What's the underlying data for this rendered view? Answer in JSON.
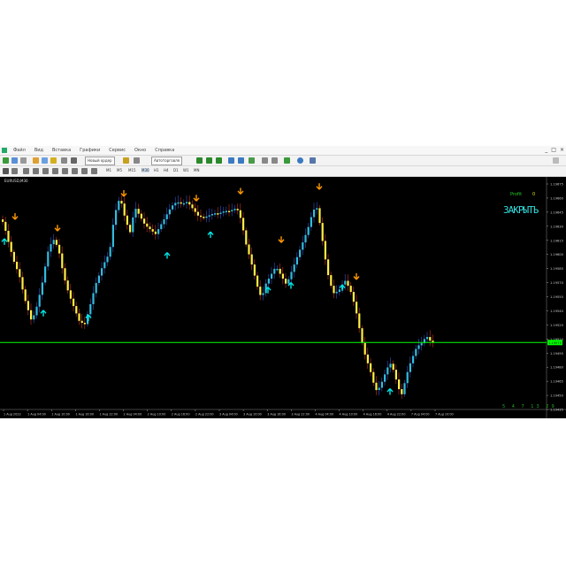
{
  "menu": [
    "Файл",
    "Вид",
    "Вставка",
    "Графики",
    "Сервис",
    "Окно",
    "Справка"
  ],
  "window_controls": [
    "_",
    "□",
    "×"
  ],
  "toolbar": {
    "new_order_label": "Новый ордер",
    "autotrading_label": "Автоторговля",
    "timeframes": [
      "M1",
      "M5",
      "M15",
      "M30",
      "H1",
      "H4",
      "D1",
      "W1",
      "MN"
    ]
  },
  "chart": {
    "symbol_label": "EURUSD,M30",
    "profit_label": "Profit",
    "profit_value": "0",
    "signal_text": "ЗАКРЫТЬ",
    "timer": "5 4 7 13 29",
    "current_price": "1.19575",
    "current_price_fraction": 0.71,
    "price_line_color": "#00ff00",
    "bull_color": "#33bbdd",
    "bear_color": "#ffee44",
    "up_arrow_color": "#00e5e5",
    "down_arrow_color": "#ff9900"
  },
  "chart_data": {
    "type": "candlestick",
    "y_ticks": [
      "1.19675",
      "1.19660",
      "1.19645",
      "1.19630",
      "1.19615",
      "1.19600",
      "1.19585",
      "1.19570",
      "1.19555",
      "1.19540",
      "1.19525",
      "1.19510",
      "1.19495",
      "1.19480",
      "1.19465",
      "1.19450",
      "1.19435"
    ],
    "x_ticks": [
      "1 Aug 2023",
      "1 Aug 04:00",
      "1 Aug 10:00",
      "1 Aug 16:00",
      "1 Aug 22:00",
      "2 Aug 04:00",
      "2 Aug 10:00",
      "2 Aug 16:00",
      "2 Aug 22:00",
      "3 Aug 04:00",
      "3 Aug 10:00",
      "3 Aug 16:00",
      "3 Aug 22:00",
      "4 Aug 04:00",
      "4 Aug 10:00",
      "4 Aug 16:00",
      "4 Aug 22:00",
      "7 Aug 04:00",
      "7 Aug 10:00"
    ],
    "price_path": [
      [
        0,
        0.17
      ],
      [
        6,
        0.19
      ],
      [
        12,
        0.28
      ],
      [
        18,
        0.36
      ],
      [
        24,
        0.42
      ],
      [
        30,
        0.52
      ],
      [
        38,
        0.62
      ],
      [
        44,
        0.55
      ],
      [
        50,
        0.45
      ],
      [
        56,
        0.32
      ],
      [
        62,
        0.26
      ],
      [
        68,
        0.3
      ],
      [
        74,
        0.42
      ],
      [
        80,
        0.5
      ],
      [
        86,
        0.56
      ],
      [
        92,
        0.62
      ],
      [
        98,
        0.63
      ],
      [
        104,
        0.55
      ],
      [
        110,
        0.46
      ],
      [
        118,
        0.38
      ],
      [
        126,
        0.32
      ],
      [
        130,
        0.2
      ],
      [
        134,
        0.12
      ],
      [
        138,
        0.08
      ],
      [
        142,
        0.15
      ],
      [
        146,
        0.2
      ],
      [
        150,
        0.24
      ],
      [
        154,
        0.12
      ],
      [
        160,
        0.16
      ],
      [
        166,
        0.2
      ],
      [
        172,
        0.22
      ],
      [
        178,
        0.24
      ],
      [
        184,
        0.2
      ],
      [
        190,
        0.16
      ],
      [
        196,
        0.12
      ],
      [
        202,
        0.1
      ],
      [
        208,
        0.11
      ],
      [
        214,
        0.1
      ],
      [
        220,
        0.13
      ],
      [
        226,
        0.16
      ],
      [
        232,
        0.17
      ],
      [
        238,
        0.16
      ],
      [
        244,
        0.15
      ],
      [
        250,
        0.15
      ],
      [
        256,
        0.14
      ],
      [
        262,
        0.14
      ],
      [
        268,
        0.13
      ],
      [
        272,
        0.14
      ],
      [
        276,
        0.2
      ],
      [
        280,
        0.28
      ],
      [
        286,
        0.36
      ],
      [
        290,
        0.42
      ],
      [
        294,
        0.48
      ],
      [
        298,
        0.52
      ],
      [
        302,
        0.46
      ],
      [
        308,
        0.42
      ],
      [
        314,
        0.38
      ],
      [
        320,
        0.42
      ],
      [
        326,
        0.46
      ],
      [
        332,
        0.4
      ],
      [
        338,
        0.34
      ],
      [
        344,
        0.28
      ],
      [
        350,
        0.22
      ],
      [
        356,
        0.14
      ],
      [
        360,
        0.12
      ],
      [
        364,
        0.2
      ],
      [
        368,
        0.3
      ],
      [
        372,
        0.4
      ],
      [
        376,
        0.46
      ],
      [
        380,
        0.5
      ],
      [
        386,
        0.48
      ],
      [
        392,
        0.44
      ],
      [
        398,
        0.48
      ],
      [
        404,
        0.56
      ],
      [
        408,
        0.64
      ],
      [
        412,
        0.72
      ],
      [
        416,
        0.78
      ],
      [
        420,
        0.82
      ],
      [
        424,
        0.88
      ],
      [
        428,
        0.92
      ],
      [
        432,
        0.9
      ],
      [
        436,
        0.86
      ],
      [
        440,
        0.82
      ],
      [
        444,
        0.8
      ],
      [
        448,
        0.84
      ],
      [
        452,
        0.9
      ],
      [
        456,
        0.94
      ],
      [
        460,
        0.88
      ],
      [
        464,
        0.82
      ],
      [
        468,
        0.78
      ],
      [
        472,
        0.74
      ],
      [
        476,
        0.72
      ],
      [
        480,
        0.71
      ],
      [
        484,
        0.68
      ],
      [
        488,
        0.7
      ],
      [
        490,
        0.71
      ]
    ],
    "down_arrows": [
      [
        17,
        0.15
      ],
      [
        65,
        0.2
      ],
      [
        140,
        0.05
      ],
      [
        222,
        0.07
      ],
      [
        272,
        0.04
      ],
      [
        318,
        0.25
      ],
      [
        361,
        0.02
      ],
      [
        403,
        0.41
      ]
    ],
    "up_arrows": [
      [
        5,
        0.26
      ],
      [
        49,
        0.57
      ],
      [
        100,
        0.59
      ],
      [
        189,
        0.32
      ],
      [
        238,
        0.23
      ],
      [
        303,
        0.47
      ],
      [
        329,
        0.45
      ],
      [
        387,
        0.46
      ],
      [
        441,
        0.91
      ]
    ]
  }
}
